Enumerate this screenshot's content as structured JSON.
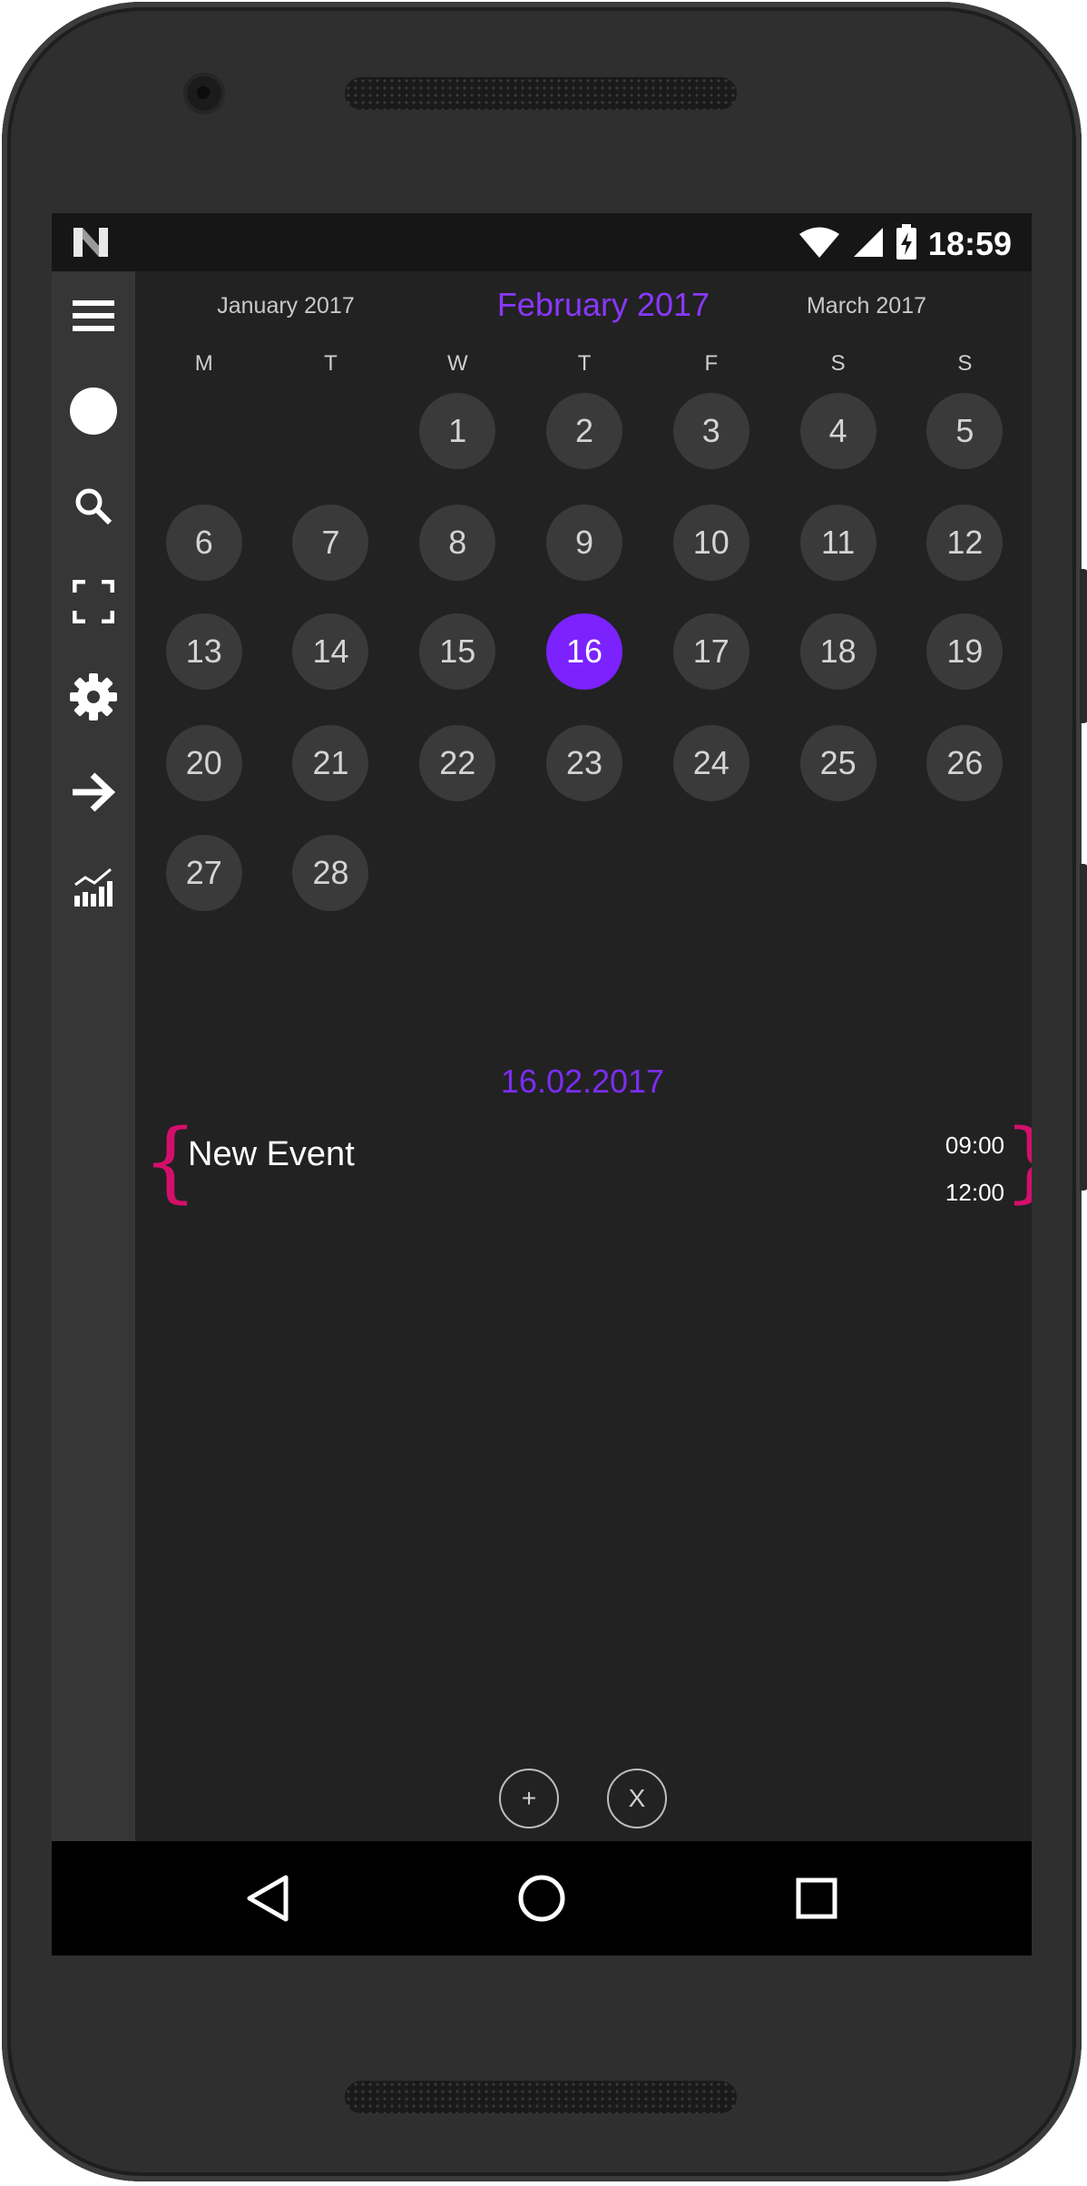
{
  "status_bar": {
    "time": "18:59",
    "logo_icon": "n-logo-icon",
    "icons": [
      "wifi-icon",
      "signal-icon",
      "battery-charging-icon"
    ]
  },
  "sidebar": {
    "items": [
      {
        "icon": "menu-icon"
      },
      {
        "icon": "circle-icon"
      },
      {
        "icon": "search-icon"
      },
      {
        "icon": "fullscreen-icon"
      },
      {
        "icon": "gear-icon"
      },
      {
        "icon": "arrow-right-icon"
      },
      {
        "icon": "chart-icon"
      }
    ]
  },
  "calendar": {
    "prev_month": "January 2017",
    "current_month": "February 2017",
    "next_month": "March 2017",
    "weekdays": [
      "M",
      "T",
      "W",
      "T",
      "F",
      "S",
      "S"
    ],
    "days": [
      "",
      "",
      "1",
      "2",
      "3",
      "4",
      "5",
      "6",
      "7",
      "8",
      "9",
      "10",
      "11",
      "12",
      "13",
      "14",
      "15",
      "16",
      "17",
      "18",
      "19",
      "20",
      "21",
      "22",
      "23",
      "24",
      "25",
      "26",
      "27",
      "28",
      "",
      "",
      "",
      "",
      ""
    ],
    "selected_day": "16",
    "accent_color": "#7b22ff"
  },
  "events": {
    "date": "16.02.2017",
    "items": [
      {
        "title": "New Event",
        "start": "09:00",
        "end": "12:00"
      }
    ],
    "brace_color": "#d40f6a"
  },
  "actions": {
    "add_label": "+",
    "close_label": "X"
  },
  "nav_bar": {
    "icons": [
      "back-icon",
      "home-icon",
      "recents-icon"
    ]
  }
}
